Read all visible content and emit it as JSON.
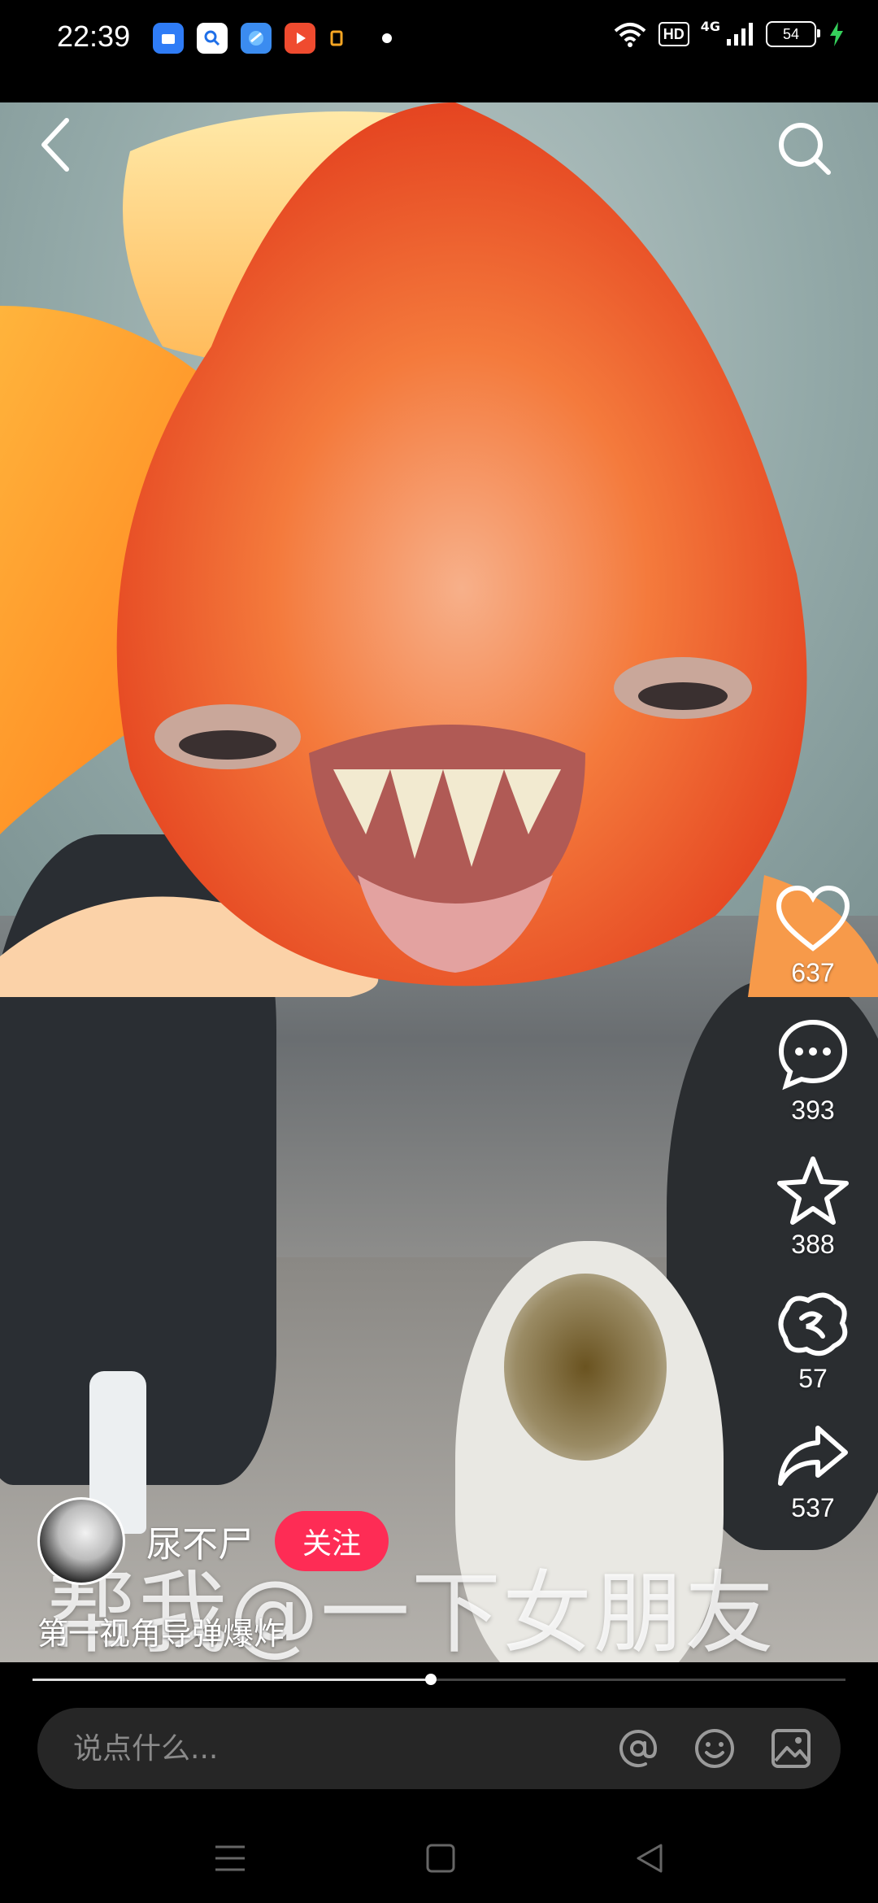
{
  "status_bar": {
    "time": "22:39",
    "app_icons": [
      "blue-app-icon",
      "search-app-icon",
      "browser-app-icon",
      "video-app-icon",
      "small-app-icon"
    ],
    "network": "4G",
    "hd_label": "HD",
    "battery": "54"
  },
  "video": {
    "overlay_caption": "帮我@一下女朋友"
  },
  "actions": {
    "like_count": "637",
    "comment_count": "393",
    "favorite_count": "388",
    "gift_count": "57",
    "share_count": "537"
  },
  "author": {
    "name": "尿不尸",
    "follow_label": "关注"
  },
  "description": "第一视角导弹爆炸",
  "progress": {
    "fraction": 0.49
  },
  "comment_bar": {
    "placeholder": "说点什么..."
  },
  "colors": {
    "accent": "#fe2c55",
    "background": "#000000",
    "input_bg": "#262626"
  }
}
